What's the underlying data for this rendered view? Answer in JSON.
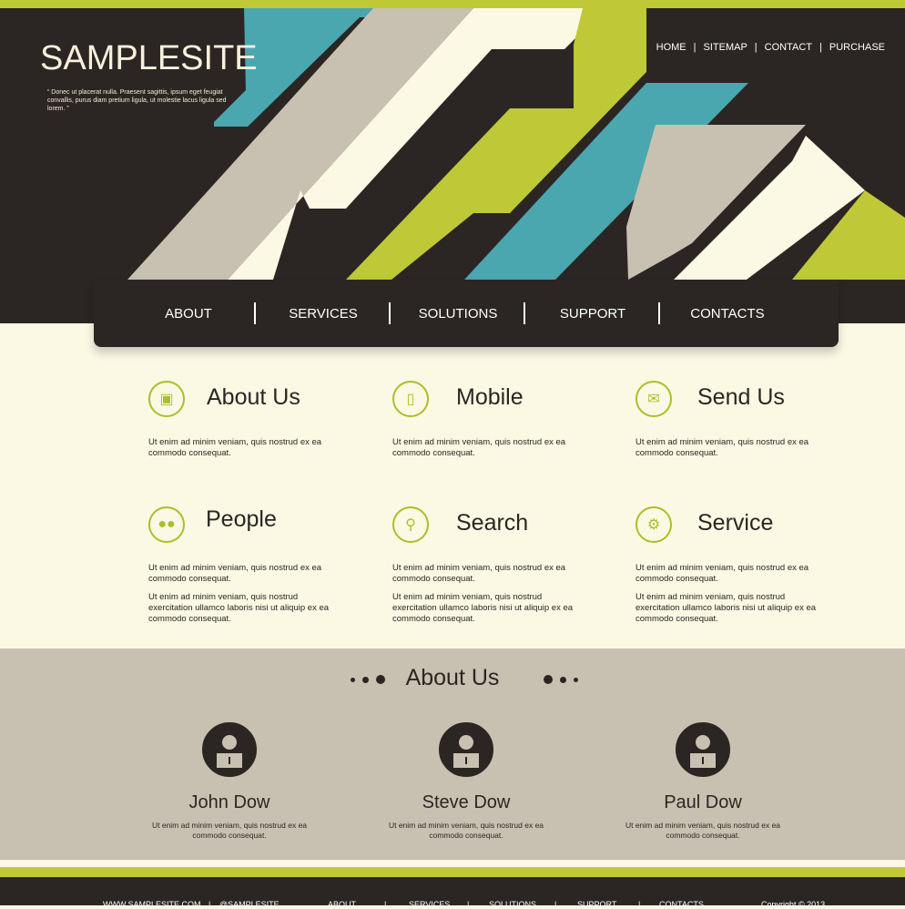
{
  "header": {
    "logo": "SAMPLESITE",
    "tagline": "“ Donec ut placerat nulla. Praesent sagittis, ipsum eget feugiat convallis, purus diam pretium ligula, ut molestie lacus ligula sed lorem. ”",
    "top_nav": [
      "HOME",
      "SITEMAP",
      "CONTACT",
      "PURCHASE"
    ]
  },
  "main_nav": [
    "ABOUT",
    "SERVICES",
    "SOLUTIONS",
    "SUPPORT",
    "CONTACTS"
  ],
  "colors": {
    "accent": "#bfc836",
    "dark": "#2b2623",
    "teal": "#4aa7b0",
    "beige": "#c8c1b1",
    "cream": "#fbf8e3"
  },
  "features": [
    {
      "icon": "book-icon",
      "title": "About Us",
      "p1": "Ut enim ad minim veniam, quis nostrud ex ea commodo consequat."
    },
    {
      "icon": "mobile-icon",
      "title": "Mobile",
      "p1": "Ut enim ad minim veniam, quis nostrud ex ea commodo consequat."
    },
    {
      "icon": "mail-icon",
      "title": "Send Us",
      "p1": "Ut enim ad minim veniam, quis nostrud ex ea commodo consequat."
    },
    {
      "icon": "people-icon",
      "title": "People",
      "p1": "Ut enim ad minim veniam, quis nostrud ex ea commodo consequat.",
      "p2": "Ut enim ad minim veniam, quis nostrud exercitation ullamco laboris nisi ut aliquip ex ea commodo consequat."
    },
    {
      "icon": "search-icon",
      "title": "Search",
      "p1": "Ut enim ad minim veniam, quis nostrud ex ea commodo consequat.",
      "p2": "Ut enim ad minim veniam, quis nostrud exercitation ullamco laboris nisi ut aliquip ex ea commodo consequat."
    },
    {
      "icon": "gear-icon",
      "title": "Service",
      "p1": "Ut enim ad minim veniam, quis nostrud ex ea commodo consequat.",
      "p2": "Ut enim ad minim veniam, quis nostrud exercitation ullamco laboris nisi ut aliquip ex ea commodo consequat."
    }
  ],
  "team": {
    "title": "About Us",
    "members": [
      {
        "name": "John Dow",
        "text": "Ut enim ad minim veniam, quis nostrud ex ea commodo consequat."
      },
      {
        "name": "Steve Dow",
        "text": "Ut enim ad minim veniam, quis nostrud ex ea commodo consequat."
      },
      {
        "name": "Paul Dow",
        "text": "Ut enim ad minim veniam, quis nostrud ex ea commodo consequat."
      }
    ]
  },
  "footer": {
    "site": "WWW.SAMPLESITE.COM",
    "handle": "@SAMPLESITE",
    "nav": [
      "ABOUT",
      "SERVICES",
      "SOLUTIONS",
      "SUPPORT",
      "CONTACTS"
    ],
    "copyright": "Copyright © 2013"
  }
}
